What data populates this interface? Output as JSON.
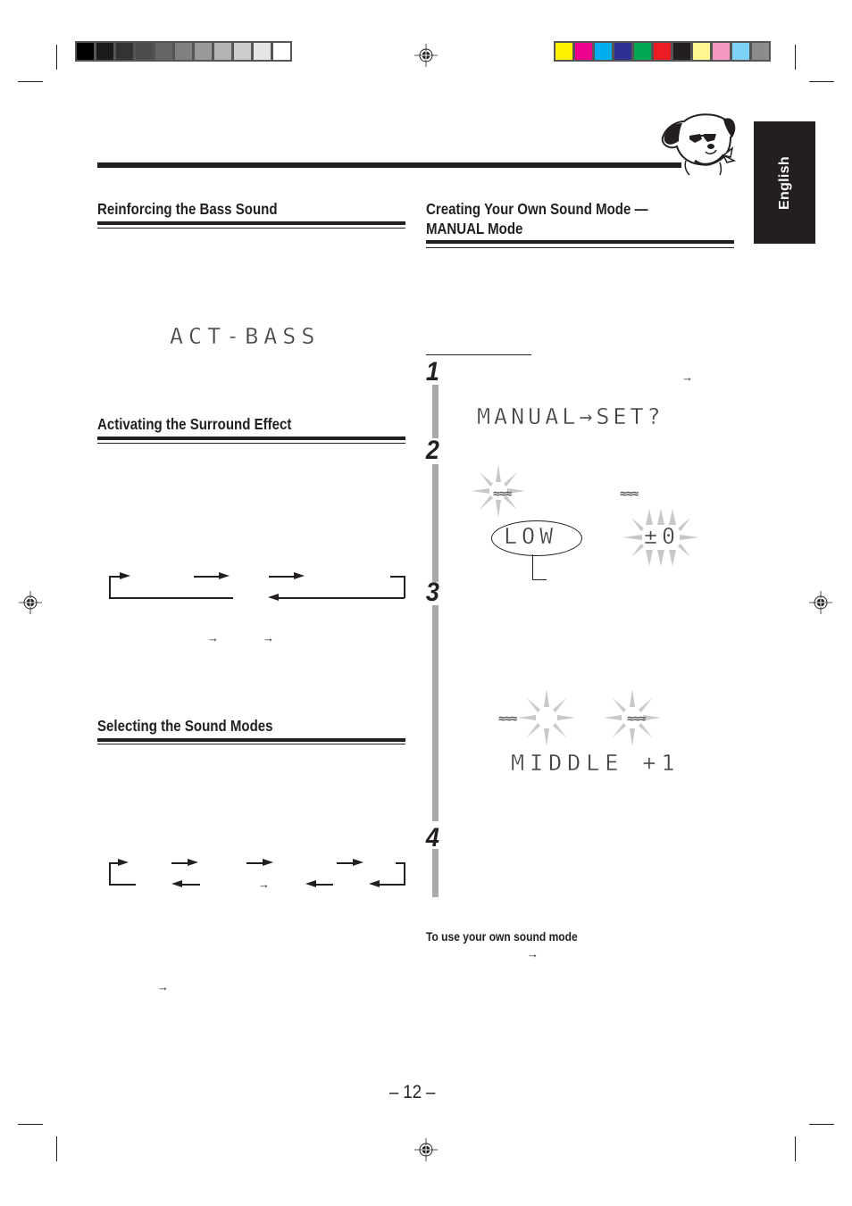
{
  "page": {
    "language_tab": "English",
    "page_number": "– 12 –"
  },
  "color_bars": {
    "grayscale": [
      "#000000",
      "#1a1a1a",
      "#333333",
      "#4d4d4d",
      "#666666",
      "#808080",
      "#999999",
      "#b3b3b3",
      "#cccccc",
      "#e6e6e6",
      "#ffffff"
    ],
    "process": [
      "#fff200",
      "#ec008c",
      "#00aeef",
      "#2e3192",
      "#00a651",
      "#ed1c24",
      "#231f20",
      "#fff68f",
      "#f49ac1",
      "#7dd3f7",
      "#8c8c8c"
    ]
  },
  "left_column": {
    "sections": [
      {
        "title": "Reinforcing the Bass Sound",
        "display": "ACT-BASS"
      },
      {
        "title": "Activating the Surround Effect"
      },
      {
        "title": "Selecting the Sound Modes"
      }
    ]
  },
  "right_column": {
    "title_line1": "Creating Your Own Sound Mode —",
    "title_line2": "MANUAL Mode",
    "steps": [
      {
        "number": "1",
        "display": "MANUAL→SET?"
      },
      {
        "number": "2",
        "display_left": "LOW",
        "display_right": "±0"
      },
      {
        "number": "3",
        "display": "MIDDLE +1"
      },
      {
        "number": "4"
      }
    ],
    "note_heading": "To use your own sound mode"
  },
  "icons": {
    "mascot": "dog-with-sunglasses-icon",
    "registration": "registration-mark-icon",
    "arrow": "→",
    "eq_bars": "≈≈≈"
  }
}
